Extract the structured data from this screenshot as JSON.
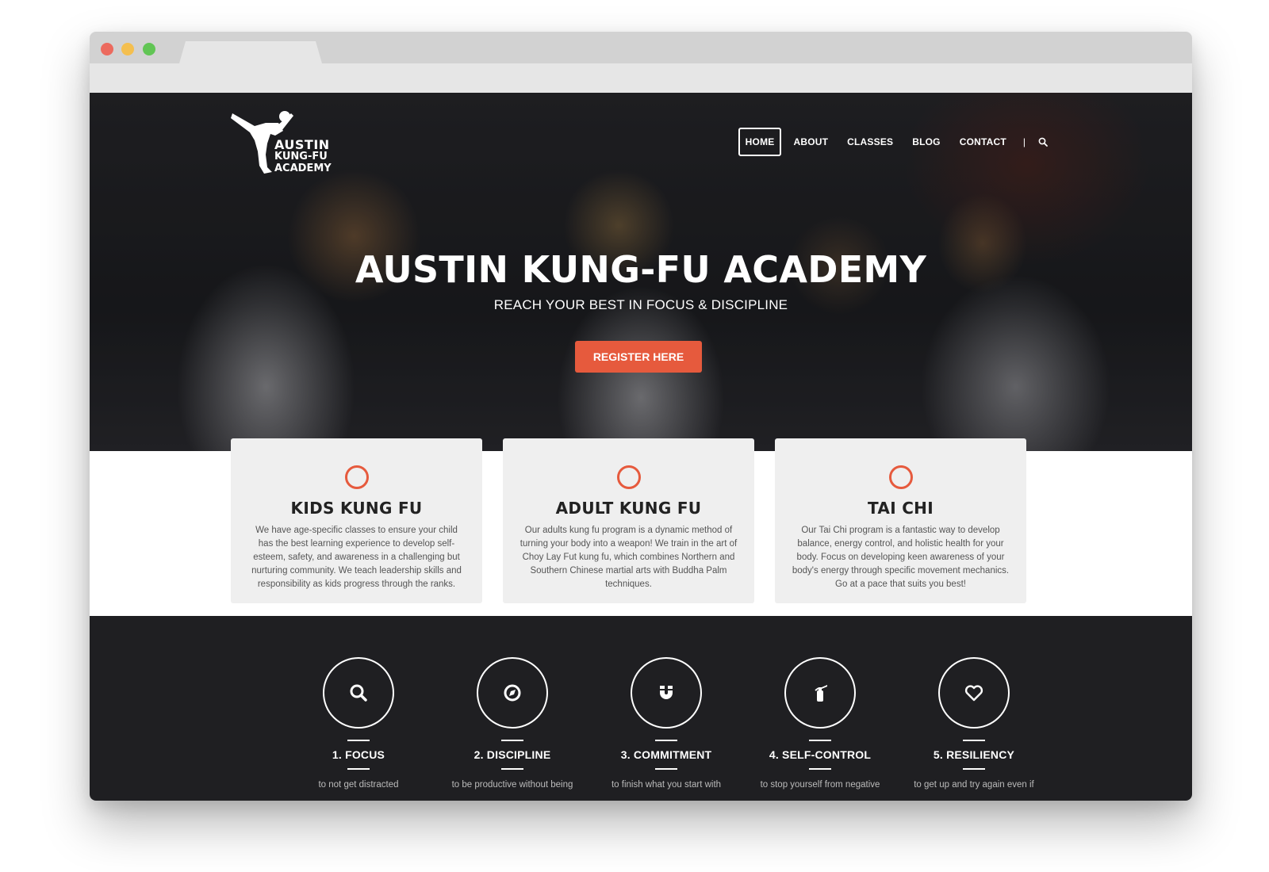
{
  "logo": {
    "line1": "AUSTIN",
    "line2": "KUNG-FU",
    "line3": "ACADEMY"
  },
  "nav": {
    "items": [
      {
        "label": "HOME",
        "active": true
      },
      {
        "label": "ABOUT"
      },
      {
        "label": "CLASSES"
      },
      {
        "label": "BLOG"
      },
      {
        "label": "CONTACT"
      }
    ],
    "separator": "|",
    "search_icon": "search-icon"
  },
  "hero": {
    "title": "AUSTIN KUNG-FU ACADEMY",
    "subtitle": "REACH YOUR BEST IN FOCUS & DISCIPLINE",
    "button_label": "REGISTER HERE"
  },
  "cards": [
    {
      "title": "KIDS KUNG FU",
      "text": "We have age-specific classes to ensure your child has the best learning experience to develop self-esteem, safety, and awareness in a challenging but nurturing community. We teach leadership skills and responsibility as kids progress through the ranks."
    },
    {
      "title": "ADULT KUNG FU",
      "text": "Our adults kung fu program is a dynamic method of turning your body into a weapon! We train in the art of Choy Lay Fut kung fu, which combines Northern and Southern Chinese martial arts with Buddha Palm techniques."
    },
    {
      "title": "TAI CHI",
      "text": "Our Tai Chi program is a fantastic way to develop balance, energy control, and holistic health for your body. Focus on developing keen awareness of your body's energy through specific movement mechanics. Go at a pace that suits you best!"
    }
  ],
  "values": [
    {
      "title": "1. FOCUS",
      "desc": "to not get distracted",
      "icon": "search-icon"
    },
    {
      "title": "2. DISCIPLINE",
      "desc": "to be productive without being",
      "icon": "compass-icon"
    },
    {
      "title": "3. COMMITMENT",
      "desc": "to finish what you start with",
      "icon": "magnet-icon"
    },
    {
      "title": "4. SELF-CONTROL",
      "desc": "to stop yourself from negative",
      "icon": "extinguisher-icon"
    },
    {
      "title": "5. RESILIENCY",
      "desc": "to get up and try again even if",
      "icon": "heart-icon"
    }
  ],
  "colors": {
    "accent": "#e65a3d",
    "dark": "#1f1f22",
    "card": "#efefef"
  }
}
